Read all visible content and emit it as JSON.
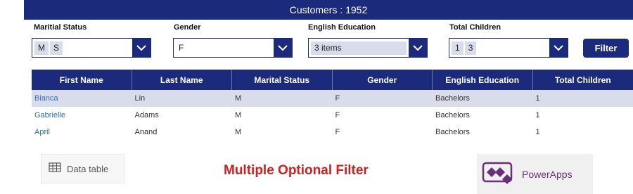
{
  "header": {
    "title": "Customers : 1952"
  },
  "filters": {
    "marital_status": {
      "label": "Maritial Status",
      "chips": [
        "M",
        "S"
      ]
    },
    "gender": {
      "label": "Gender",
      "value": "F"
    },
    "english_education": {
      "label": "English Education",
      "chip": "3 items"
    },
    "total_children": {
      "label": "Total Children",
      "chips": [
        "1",
        "3"
      ]
    },
    "filter_button": "Filter"
  },
  "table": {
    "columns": [
      "First Name",
      "Last Name",
      "Marital Status",
      "Gender",
      "English Education",
      "Total Children"
    ],
    "rows": [
      [
        "Bianca",
        "Lin",
        "M",
        "F",
        "Bachelors",
        "1"
      ],
      [
        "Gabrielle",
        "Adams",
        "M",
        "F",
        "Bachelors",
        "1"
      ],
      [
        "April",
        "Anand",
        "M",
        "F",
        "Bachelors",
        "1"
      ]
    ],
    "selected_row": 0
  },
  "data_table_control": {
    "label": "Data table",
    "icon": "table-icon"
  },
  "caption": "Multiple Optional Filter",
  "powerapps": {
    "label": "PowerApps",
    "icon": "powerapps-logo-icon"
  },
  "colors": {
    "primary": "#1b2a7a",
    "selected_row": "#d9dcea",
    "chip": "#d9dcea",
    "link": "#2a6fbd",
    "caption": "#d11f1f",
    "powerapps": "#6a2f79"
  }
}
